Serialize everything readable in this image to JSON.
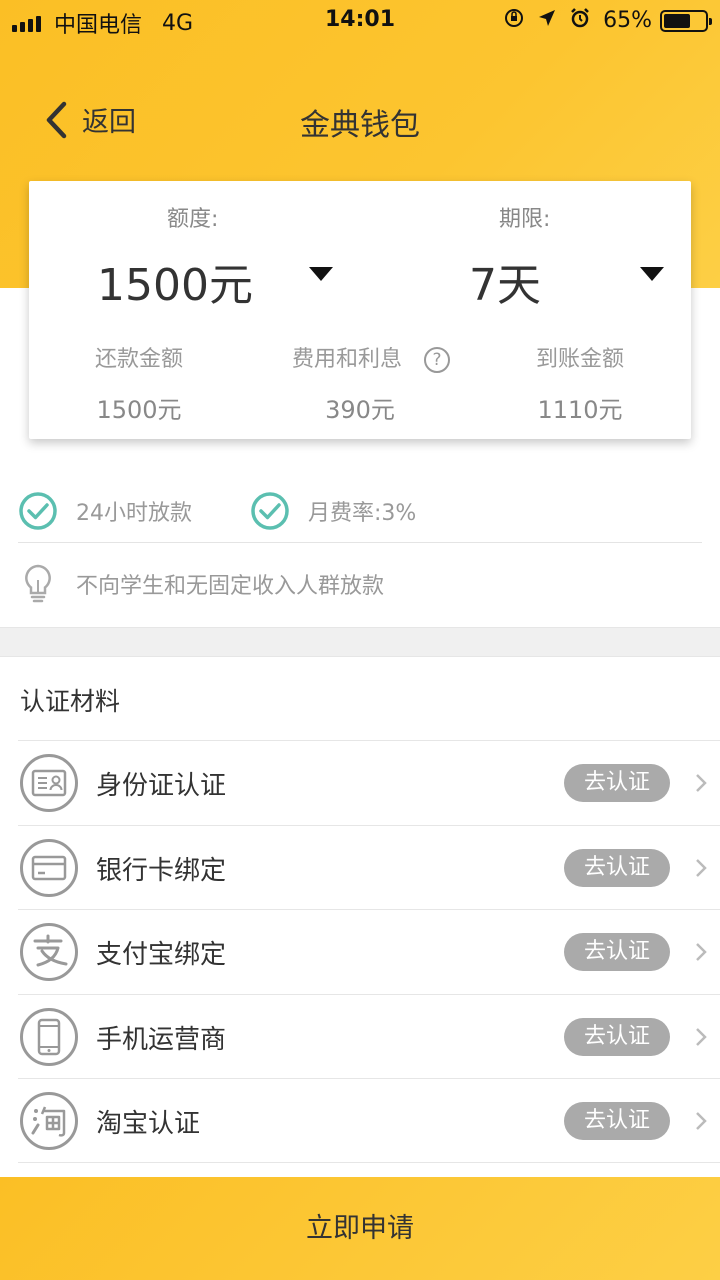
{
  "status_bar": {
    "carrier": "中国电信",
    "network": "4G",
    "time": "14:01",
    "battery_percent": "65%",
    "battery_level": 0.65,
    "icons": [
      "orientation-lock-icon",
      "location-arrow-icon",
      "alarm-icon"
    ]
  },
  "nav": {
    "back_label": "返回",
    "title": "金典钱包"
  },
  "loan_card": {
    "amount_label": "额度:",
    "amount_value": "1500元",
    "term_label": "期限:",
    "term_value": "7天",
    "repay_label": "还款金额",
    "repay_value": "1500元",
    "fee_label": "费用和利息",
    "fee_value": "390元",
    "received_label": "到账金额",
    "received_value": "1110元"
  },
  "features": [
    {
      "text": "24小时放款",
      "icon": "check-circle-icon"
    },
    {
      "text": "月费率:3%",
      "icon": "check-circle-icon"
    }
  ],
  "notice": {
    "icon": "lightbulb-icon",
    "text": "不向学生和无固定收入人群放款"
  },
  "materials": {
    "title": "认证材料",
    "items": [
      {
        "label": "身份证认证",
        "button": "去认证",
        "icon": "id-card-icon"
      },
      {
        "label": "银行卡绑定",
        "button": "去认证",
        "icon": "bank-card-icon"
      },
      {
        "label": "支付宝绑定",
        "button": "去认证",
        "icon": "alipay-icon"
      },
      {
        "label": "手机运营商",
        "button": "去认证",
        "icon": "mobile-phone-icon"
      },
      {
        "label": "淘宝认证",
        "button": "去认证",
        "icon": "taobao-icon"
      }
    ]
  },
  "apply_button": "立即申请",
  "colors": {
    "brand_yellow": "#fcc530",
    "check_teal": "#5bbfb0",
    "button_gray": "#aaaaaa"
  }
}
